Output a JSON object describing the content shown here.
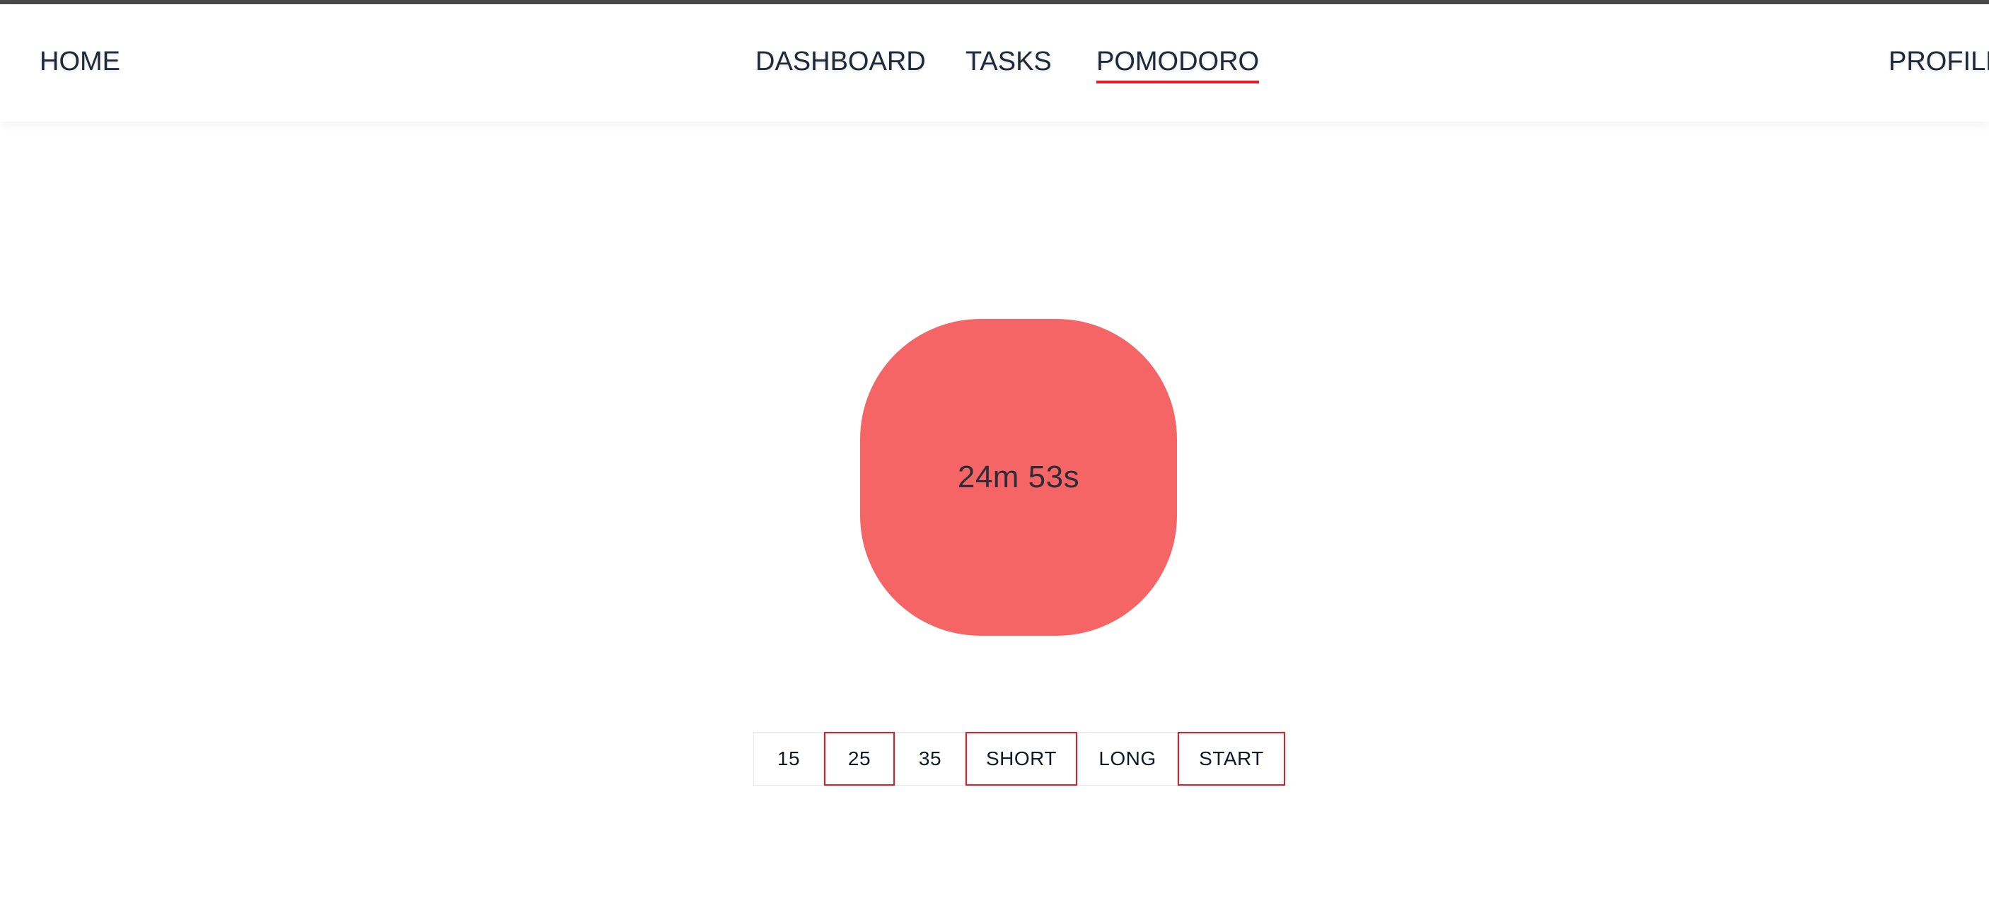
{
  "nav": {
    "home": "HOME",
    "dashboard": "DASHBOARD",
    "tasks": "TASKS",
    "pomodoro": "POMODORO",
    "profile": "PROFILE",
    "active": "POMODORO"
  },
  "timer": {
    "display": "24m 53s",
    "color": "#f56565"
  },
  "controls": {
    "durations": [
      "15",
      "25",
      "35"
    ],
    "selected_duration": "25",
    "short_label": "SHORT",
    "long_label": "LONG",
    "start_label": "START",
    "accent_color": "#e11d2a"
  }
}
